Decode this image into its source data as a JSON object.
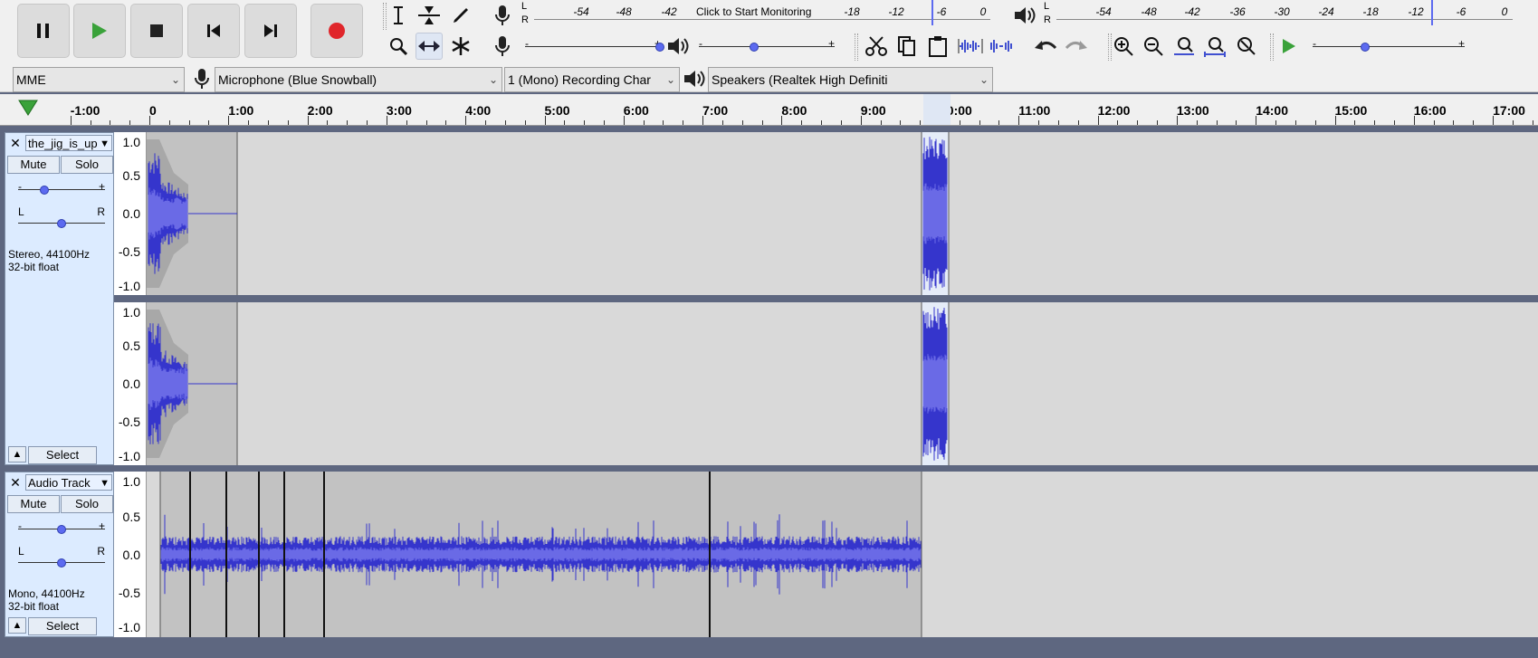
{
  "toolbar": {
    "transport": [
      "pause",
      "play",
      "stop",
      "skip-start",
      "skip-end",
      "record"
    ],
    "meter_record": {
      "l": "L",
      "r": "R",
      "ticks": [
        "-54",
        "-48",
        "-42",
        "-18",
        "-12",
        "-6",
        "0"
      ],
      "message": "Click to Start Monitoring"
    },
    "meter_play": {
      "l": "L",
      "r": "R",
      "ticks": [
        "-54",
        "-48",
        "-42",
        "-36",
        "-30",
        "-24",
        "-18",
        "-12",
        "-6",
        "0"
      ]
    },
    "slider_minus": "-",
    "slider_plus": "+"
  },
  "device": {
    "host": "MME",
    "input": "Microphone (Blue Snowball)",
    "channels": "1 (Mono) Recording Char",
    "output": "Speakers (Realtek High Definiti"
  },
  "ruler": {
    "labels": [
      "-1:00",
      "0",
      "1:00",
      "2:00",
      "3:00",
      "4:00",
      "5:00",
      "6:00",
      "7:00",
      "8:00",
      "9:00",
      "10:00",
      "11:00",
      "12:00",
      "13:00",
      "14:00",
      "15:00",
      "16:00",
      "17:00"
    ]
  },
  "tracks": [
    {
      "name": "the_jig_is_up",
      "mute": "Mute",
      "solo": "Solo",
      "gain_minus": "-",
      "gain_plus": "+",
      "pan_l": "L",
      "pan_r": "R",
      "info1": "Stereo, 44100Hz",
      "info2": "32-bit float",
      "select": "Select",
      "collapse": "▲",
      "scale": [
        "1.0",
        "0.5",
        "0.0",
        "-0.5",
        "-1.0"
      ]
    },
    {
      "name": "Audio Track",
      "mute": "Mute",
      "solo": "Solo",
      "gain_minus": "-",
      "gain_plus": "+",
      "pan_l": "L",
      "pan_r": "R",
      "info1": "Mono, 44100Hz",
      "info2": "32-bit float",
      "select": "Select",
      "collapse": "▲",
      "scale": [
        "1.0",
        "0.5",
        "0.0",
        "-0.5",
        "-1.0"
      ]
    }
  ],
  "colors": {
    "waveform": "#3535cc",
    "waveform_rms": "#6a6ae6",
    "selection": "#e5ecf8",
    "clip": "#c2c2c2",
    "background": "#5e6780",
    "track_ctrl": "#dcebff",
    "record": "#e0262b",
    "play": "#3aa23a"
  }
}
